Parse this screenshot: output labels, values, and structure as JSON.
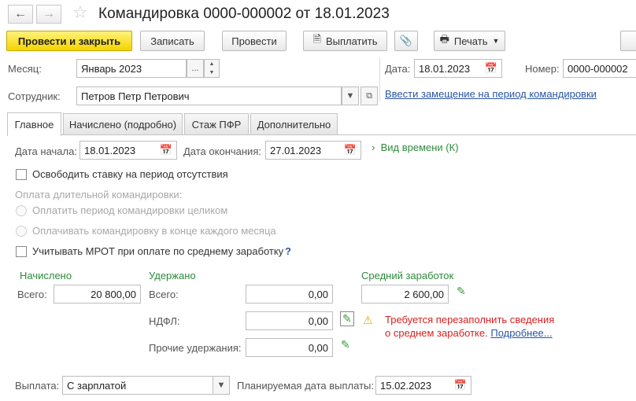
{
  "window": {
    "title": "Командировка 0000-000002 от 18.01.2023",
    "back_icon": "arrow-left-icon",
    "forward_icon": "arrow-right-icon",
    "favorite_icon": "star-icon"
  },
  "toolbar": {
    "post_close": "Провести и закрыть",
    "save": "Записать",
    "post": "Провести",
    "pay": "Выплатить",
    "print": "Печать",
    "attach_icon": "paperclip-icon"
  },
  "header": {
    "month_label": "Месяц:",
    "month_value": "Январь 2023",
    "date_label": "Дата:",
    "date_value": "18.01.2023",
    "number_label": "Номер:",
    "number_value": "0000-000002",
    "employee_label": "Сотрудник:",
    "employee_value": "Петров Петр Петрович",
    "replacement_link": "Ввести замещение на период командировки"
  },
  "tabs": [
    {
      "label": "Главное",
      "active": true
    },
    {
      "label": "Начислено (подробно)",
      "active": false
    },
    {
      "label": "Стаж ПФР",
      "active": false
    },
    {
      "label": "Дополнительно",
      "active": false
    }
  ],
  "main": {
    "start_label": "Дата начала:",
    "start_value": "18.01.2023",
    "end_label": "Дата окончания:",
    "end_value": "27.01.2023",
    "time_type": "Вид времени (К)",
    "release_rate": "Освободить ставку на период отсутствия",
    "long_trip_label": "Оплата длительной командировки:",
    "pay_whole": "Оплатить период командировки целиком",
    "pay_monthly": "Оплачивать командировку в конце каждого месяца",
    "mrot": "Учитывать МРОТ при оплате по среднему заработку",
    "mrot_help": "?"
  },
  "accrued": {
    "title": "Начислено",
    "total_label": "Всего:",
    "total_value": "20 800,00"
  },
  "withheld": {
    "title": "Удержано",
    "total_label": "Всего:",
    "total_value": "0,00",
    "ndfl_label": "НДФЛ:",
    "ndfl_value": "0,00",
    "other_label": "Прочие удержания:",
    "other_value": "0,00"
  },
  "average": {
    "title": "Средний заработок",
    "value": "2 600,00",
    "warning_line1": "Требуется перезаполнить сведения",
    "warning_line2": "о среднем заработке.",
    "details_link": "Подробнее..."
  },
  "payment": {
    "label": "Выплата:",
    "value": "С зарплатой",
    "planned_label": "Планируемая дата выплаты:",
    "planned_value": "15.02.2023"
  }
}
